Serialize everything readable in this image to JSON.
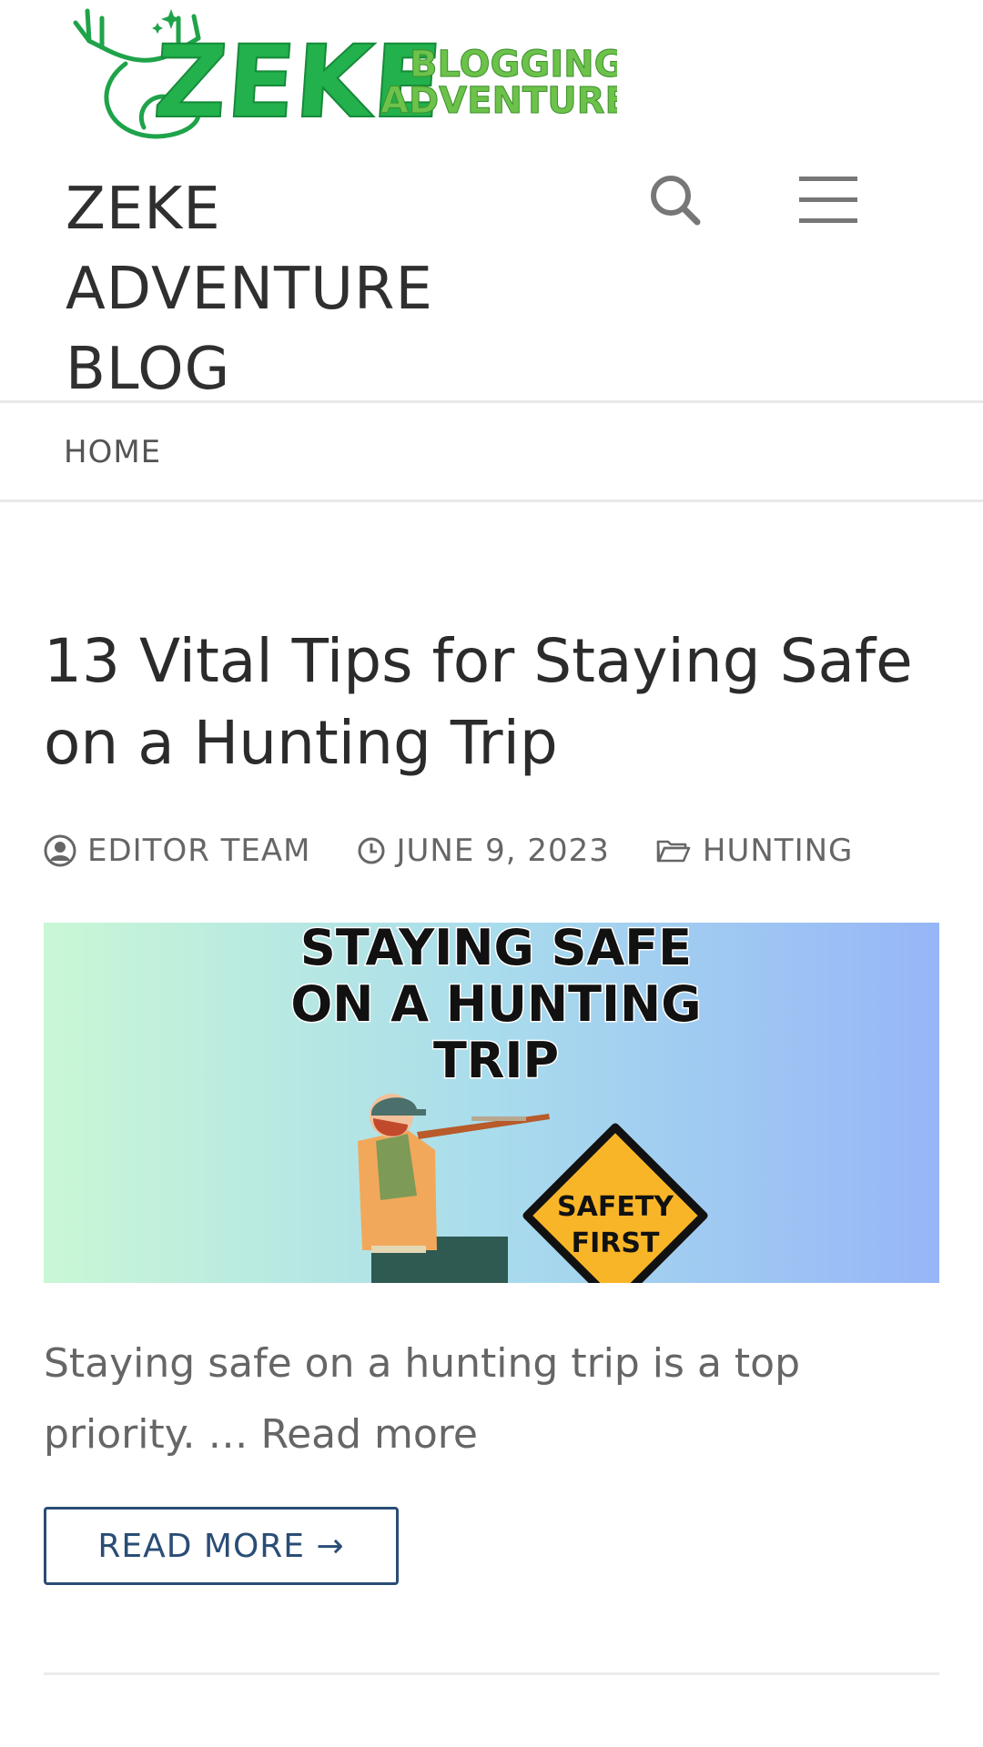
{
  "header": {
    "logo": {
      "brand": "ZEKE",
      "tagline_line1": "BLOGGING",
      "tagline_line2": "ADVENTURES",
      "icon": "deer-antler-icon",
      "colors": {
        "primary_green": "#1fb24f",
        "light_green": "#6cc24a",
        "dark_green": "#1a7a3a"
      }
    },
    "site_title_lines": [
      "ZEKE",
      "ADVENTURE",
      "BLOG"
    ],
    "search_icon": "search-icon",
    "menu_icon": "hamburger-menu-icon"
  },
  "nav": {
    "items": [
      {
        "label": "HOME"
      }
    ]
  },
  "post": {
    "title": "13 Vital Tips for Staying Safe on a Hunting Trip",
    "meta": {
      "author": "EDITOR TEAM",
      "date": "JUNE 9, 2023",
      "category": "HUNTING",
      "author_icon": "user-circle-icon",
      "date_icon": "clock-icon",
      "category_icon": "folder-icon"
    },
    "image": {
      "headline_lines": [
        "STAYING SAFE",
        "ON A HUNTING",
        "TRIP"
      ],
      "sign_lines": [
        "SAFETY",
        "FIRST"
      ],
      "colors": {
        "gradient_left": "#c9f7d6",
        "gradient_mid": "#a9dcec",
        "gradient_right": "#96b6f7",
        "sign_yellow": "#f9b528"
      }
    },
    "excerpt": "Staying safe on a hunting trip is a top priority. … ",
    "excerpt_link": "Read more",
    "read_more_button": "READ MORE →",
    "accent_color": "#2a4d76"
  }
}
